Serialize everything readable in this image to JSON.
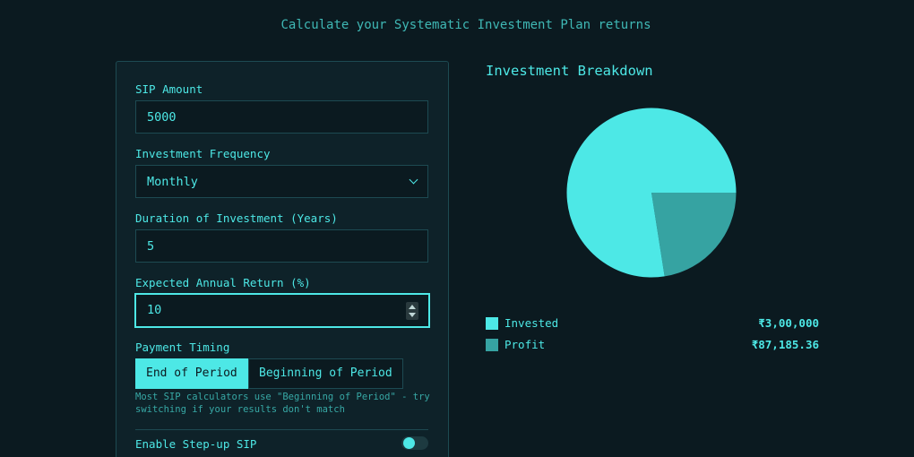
{
  "header": {
    "subtitle": "Calculate your Systematic Investment Plan returns"
  },
  "form": {
    "sip_amount": {
      "label": "SIP Amount",
      "value": "5000"
    },
    "frequency": {
      "label": "Investment Frequency",
      "value": "Monthly"
    },
    "duration": {
      "label": "Duration of Investment (Years)",
      "value": "5"
    },
    "annual_return": {
      "label": "Expected Annual Return (%)",
      "value": "10"
    },
    "payment_timing": {
      "label": "Payment Timing",
      "options": [
        "End of Period",
        "Beginning of Period"
      ],
      "selected": "End of Period",
      "hint": "Most SIP calculators use \"Beginning of Period\" - try switching if your results don't match"
    },
    "step_up": {
      "label": "Enable Step-up SIP",
      "enabled": false
    }
  },
  "breakdown": {
    "title": "Investment Breakdown",
    "legend": [
      {
        "name": "Invested",
        "value": "₹3,00,000",
        "color": "#4de8e6"
      },
      {
        "name": "Profit",
        "value": "₹87,185.36",
        "color": "#36a3a2"
      }
    ]
  },
  "chart_data": {
    "type": "pie",
    "categories": [
      "Invested",
      "Profit"
    ],
    "values": [
      300000,
      87185.36
    ],
    "colors": [
      "#4de8e6",
      "#36a3a2"
    ]
  },
  "colors": {
    "accent": "#4de8e6",
    "background": "#0b1a20",
    "panel": "#0e2229"
  }
}
